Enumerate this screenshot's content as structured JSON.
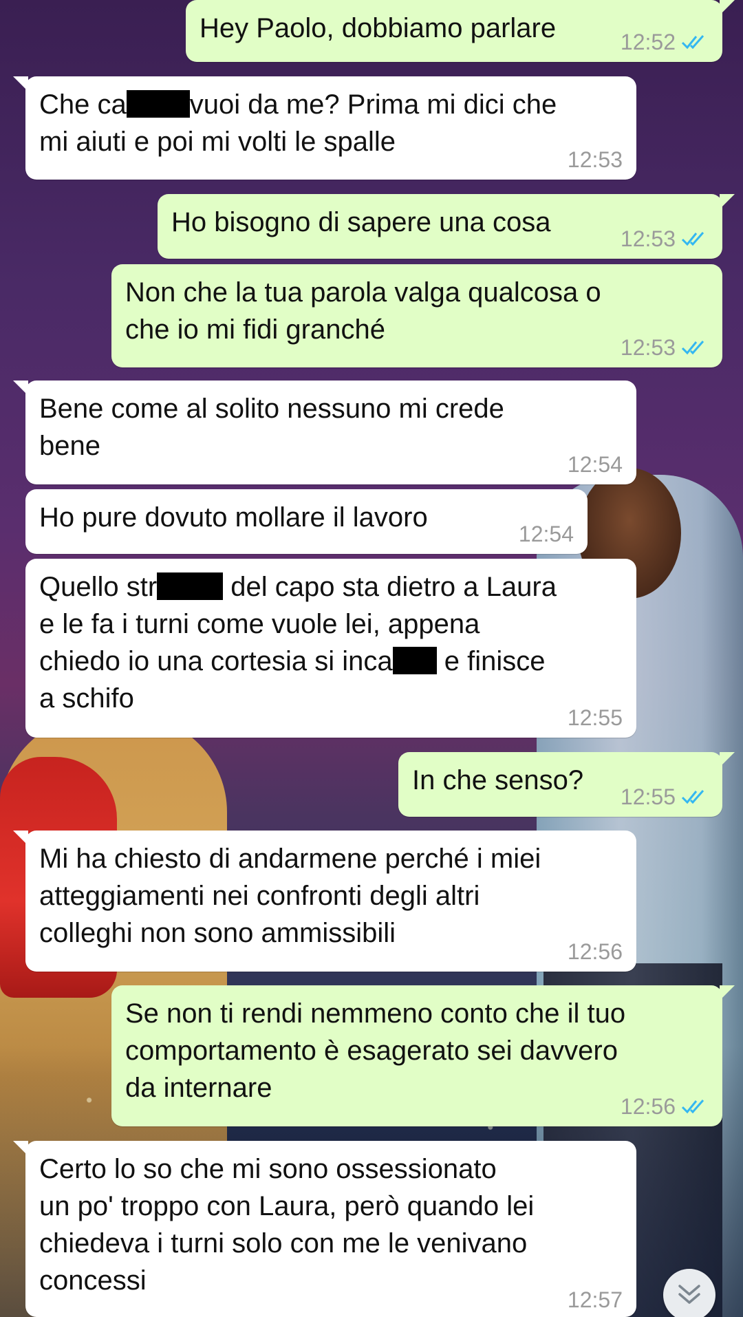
{
  "messages": [
    {
      "text": "Hey Paolo, dobbiamo parlare",
      "time": "12:52"
    },
    {
      "text_before": "Che ca",
      "text_after": "vuoi da me? Prima mi dici che\nmi aiuti e poi mi volti le spalle",
      "time": "12:53"
    },
    {
      "text": "Ho bisogno di sapere una cosa",
      "time": "12:53"
    },
    {
      "text": "Non che la tua parola valga qualcosa o\nche io mi fidi granché",
      "time": "12:53"
    },
    {
      "text": "Bene come al solito nessuno mi crede\nbene",
      "time": "12:54"
    },
    {
      "text": "Ho pure dovuto mollare il lavoro",
      "time": "12:54"
    },
    {
      "line1_before": "Quello str",
      "line1_after": " del capo sta dietro a Laura",
      "line2": "e le fa i turni come vuole lei, appena",
      "line3_before": "chiedo io una cortesia si inca",
      "line3_after": " e finisce",
      "line4": "a schifo",
      "time": "12:55"
    },
    {
      "text": "In che senso?",
      "time": "12:55"
    },
    {
      "text": "Mi ha chiesto di andarmene perché i miei\natteggiamenti nei confronti degli altri\ncolleghi non sono ammissibili",
      "time": "12:56"
    },
    {
      "text": "Se non ti rendi nemmeno conto che il tuo\ncomportamento è esagerato sei davvero\nda internare",
      "time": "12:56"
    },
    {
      "text": "Certo lo so che mi sono ossessionato\nun po' troppo con Laura, però quando lei\nchiedeva i turni solo con me le venivano\nconcessi",
      "time": "12:57"
    }
  ],
  "colors": {
    "outgoing_bubble": "#e1fec6",
    "incoming_bubble": "#ffffff",
    "read_ticks": "#34b7f1",
    "timestamp": "#9a9a9a"
  },
  "icons": {
    "read_receipt": "double-check-icon",
    "scroll_down": "double-chevron-down-icon"
  }
}
